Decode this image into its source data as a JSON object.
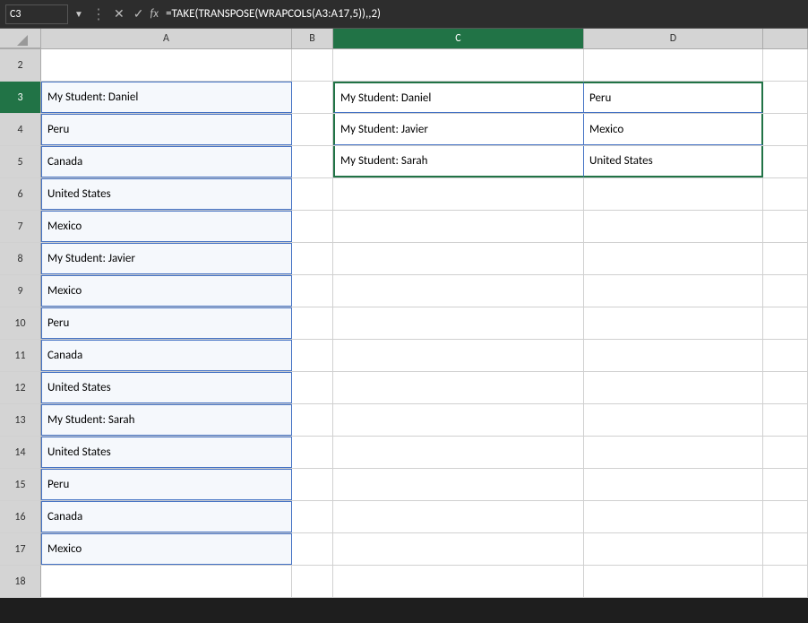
{
  "formulaBar": {
    "cellRef": "C3",
    "formula": "=TAKE(TRANSPOSE(WRAPCOLS(A3:A17,5)),,2)"
  },
  "columns": {
    "corner": "",
    "headers": [
      "A",
      "B",
      "C",
      "D"
    ]
  },
  "rows": [
    {
      "num": 2,
      "a": "",
      "b": "",
      "c": "",
      "d": ""
    },
    {
      "num": 3,
      "a": "My Student: Daniel",
      "b": "",
      "c": "My Student: Daniel",
      "d": "Peru"
    },
    {
      "num": 4,
      "a": "Peru",
      "b": "",
      "c": "My Student: Javier",
      "d": "Mexico"
    },
    {
      "num": 5,
      "a": "Canada",
      "b": "",
      "c": "My Student: Sarah",
      "d": "United States"
    },
    {
      "num": 6,
      "a": "United States",
      "b": "",
      "c": "",
      "d": ""
    },
    {
      "num": 7,
      "a": "Mexico",
      "b": "",
      "c": "",
      "d": ""
    },
    {
      "num": 8,
      "a": "My Student: Javier",
      "b": "",
      "c": "",
      "d": ""
    },
    {
      "num": 9,
      "a": "Mexico",
      "b": "",
      "c": "",
      "d": ""
    },
    {
      "num": 10,
      "a": "Peru",
      "b": "",
      "c": "",
      "d": ""
    },
    {
      "num": 11,
      "a": "Canada",
      "b": "",
      "c": "",
      "d": ""
    },
    {
      "num": 12,
      "a": "United States",
      "b": "",
      "c": "",
      "d": ""
    },
    {
      "num": 13,
      "a": "My Student: Sarah",
      "b": "",
      "c": "",
      "d": ""
    },
    {
      "num": 14,
      "a": "United States",
      "b": "",
      "c": "",
      "d": ""
    },
    {
      "num": 15,
      "a": "Peru",
      "b": "",
      "c": "",
      "d": ""
    },
    {
      "num": 16,
      "a": "Canada",
      "b": "",
      "c": "",
      "d": ""
    },
    {
      "num": 17,
      "a": "Mexico",
      "b": "",
      "c": "",
      "d": ""
    },
    {
      "num": 18,
      "a": "",
      "b": "",
      "c": "",
      "d": ""
    }
  ]
}
